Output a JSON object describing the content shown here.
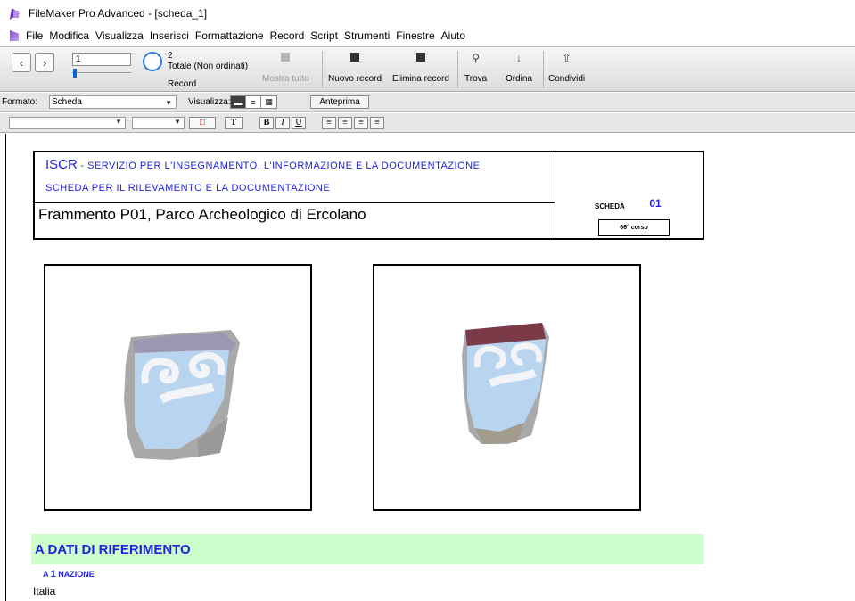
{
  "window": {
    "title": "FileMaker Pro Advanced - [scheda_1]"
  },
  "menu": [
    "File",
    "Modifica",
    "Visualizza",
    "Inserisci",
    "Formattazione",
    "Record",
    "Script",
    "Strumenti",
    "Finestre",
    "Aiuto"
  ],
  "toolbar": {
    "record_current": "1",
    "record_total": "2",
    "record_status": "Totale (Non ordinati)",
    "record_label": "Record",
    "show_all": "Mostra tutto",
    "new_record": "Nuovo record",
    "delete_record": "Elimina record",
    "find": "Trova",
    "sort": "Ordina",
    "share": "Condividi"
  },
  "layoutbar": {
    "format_label": "Formato:",
    "format_value": "Scheda",
    "view_label": "Visualizza:",
    "preview": "Anteprima"
  },
  "formatbar": {
    "text_tool": "T",
    "bold": "B",
    "italic": "I",
    "underline": "U"
  },
  "record": {
    "header_line1_prefix": "ISCR",
    "header_line1_rest": " - SERVIZIO PER L'INSEGNAMENTO, L'INFORMAZIONE E LA DOCUMENTAZIONE",
    "header_line2": "SCHEDA PER IL RILEVAMENTO E LA DOCUMENTAZIONE",
    "fragment_title": "Frammento P01, Parco Archeologico di Ercolano",
    "scheda_label": "SCHEDA",
    "scheda_number": "01",
    "course": "66° corso",
    "section_title": "A DATI DI RIFERIMENTO",
    "sub_prefix": "A ",
    "sub_number": "1",
    "sub_label": " NAZIONE",
    "nation_value": "Italia"
  },
  "colors": {
    "label_blue": "#2222dd",
    "section_green": "#ccffcc",
    "fresco_blue": "#b8d4ee",
    "fresco_white": "#f2f4f7",
    "plaster_gray": "#a9a9a9",
    "plaster_red": "#7a3a48"
  }
}
